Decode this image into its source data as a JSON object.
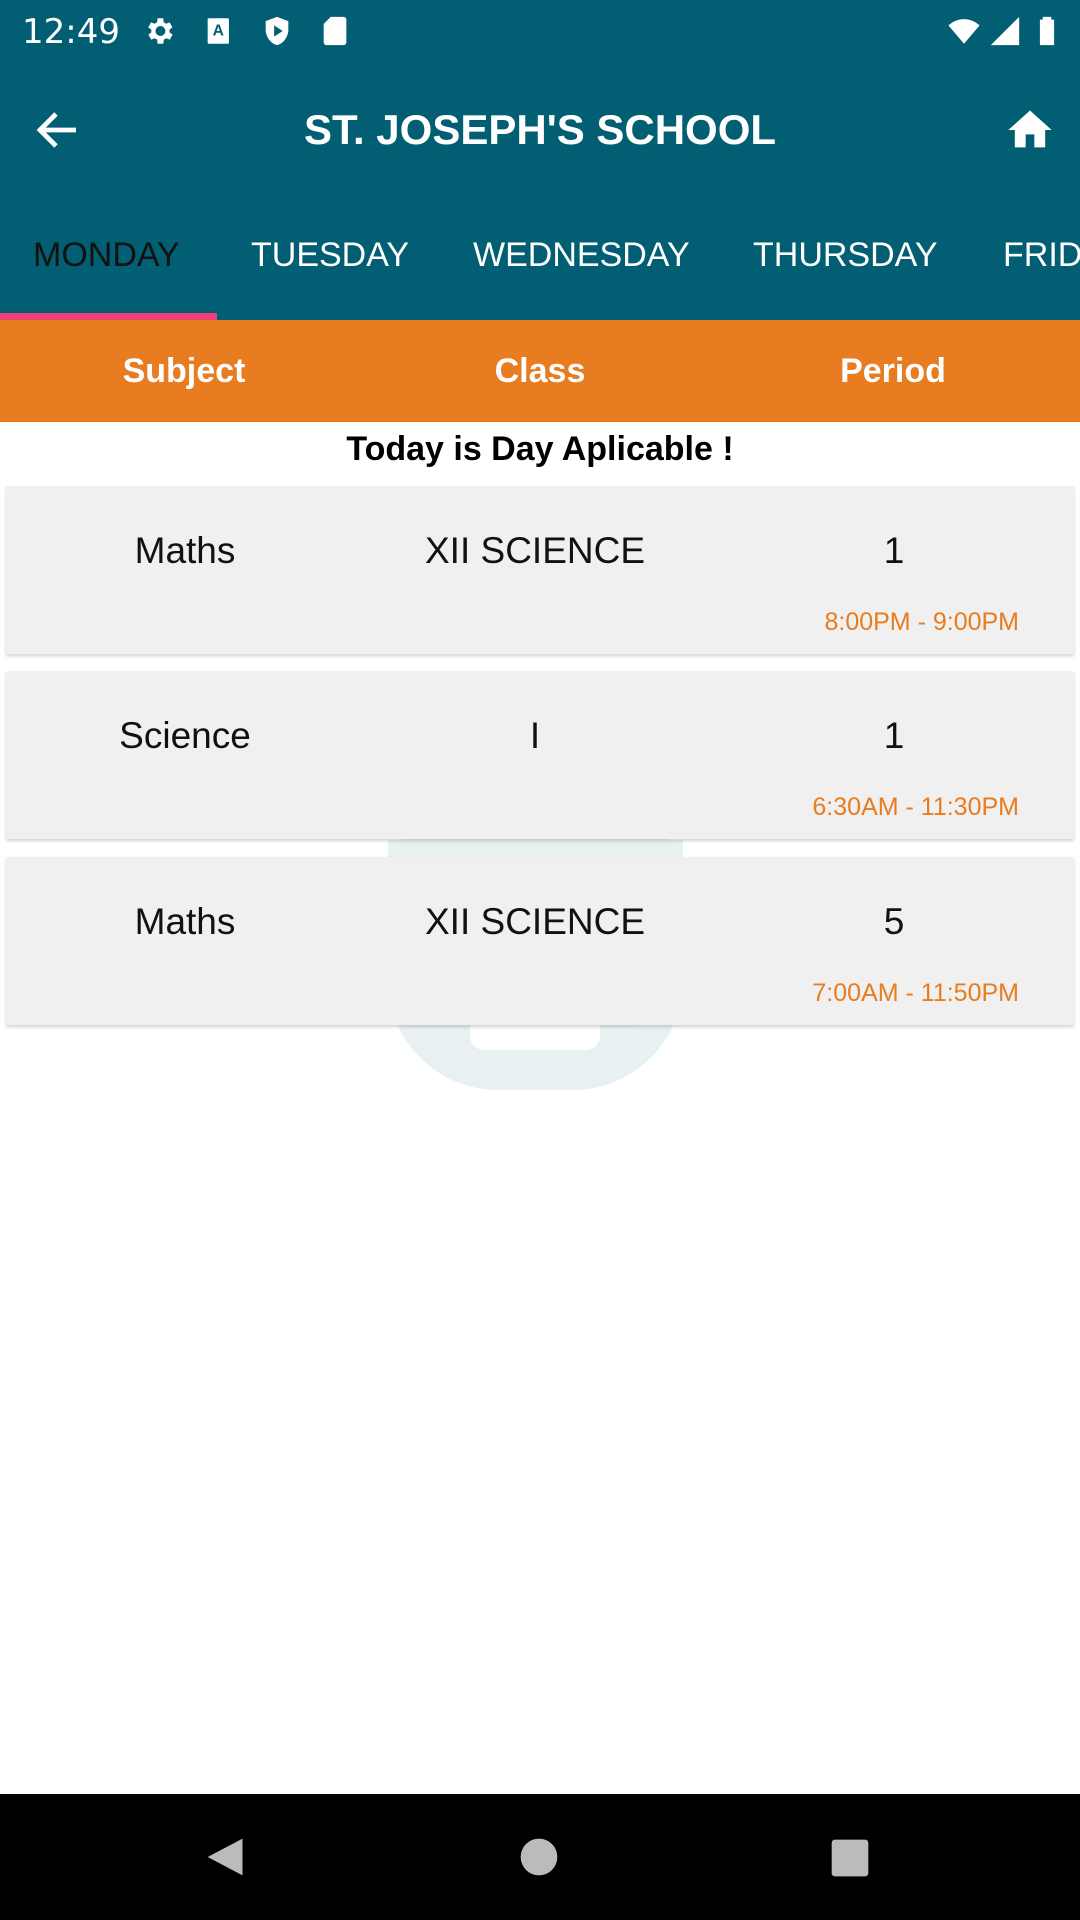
{
  "status_bar": {
    "time": "12:49",
    "icons": [
      "gear-icon",
      "a-badge-icon",
      "shield-play-icon",
      "sd-card-icon",
      "wifi-icon",
      "signal-icon",
      "battery-icon"
    ]
  },
  "app_bar": {
    "title": "ST. JOSEPH'S SCHOOL",
    "back_icon": "arrow-left-icon",
    "home_icon": "home-icon"
  },
  "tabs": [
    {
      "label": "MONDAY",
      "active": true
    },
    {
      "label": "TUESDAY"
    },
    {
      "label": "WEDNESDAY"
    },
    {
      "label": "THURSDAY"
    },
    {
      "label": "FRID"
    }
  ],
  "table_header": {
    "subject": "Subject",
    "class": "Class",
    "period": "Period"
  },
  "note": "Today is Day  Aplicable !",
  "rows": [
    {
      "subject": "Maths",
      "class": "XII SCIENCE",
      "period": "1",
      "time": "8:00PM - 9:00PM"
    },
    {
      "subject": "Science",
      "class": "I",
      "period": "1",
      "time": "6:30AM - 11:30PM"
    },
    {
      "subject": "Maths",
      "class": "XII SCIENCE",
      "period": "5",
      "time": "7:00AM - 11:50PM"
    }
  ],
  "colors": {
    "primary": "#025e73",
    "accent": "#e87c20",
    "indicator": "#f0407a"
  }
}
